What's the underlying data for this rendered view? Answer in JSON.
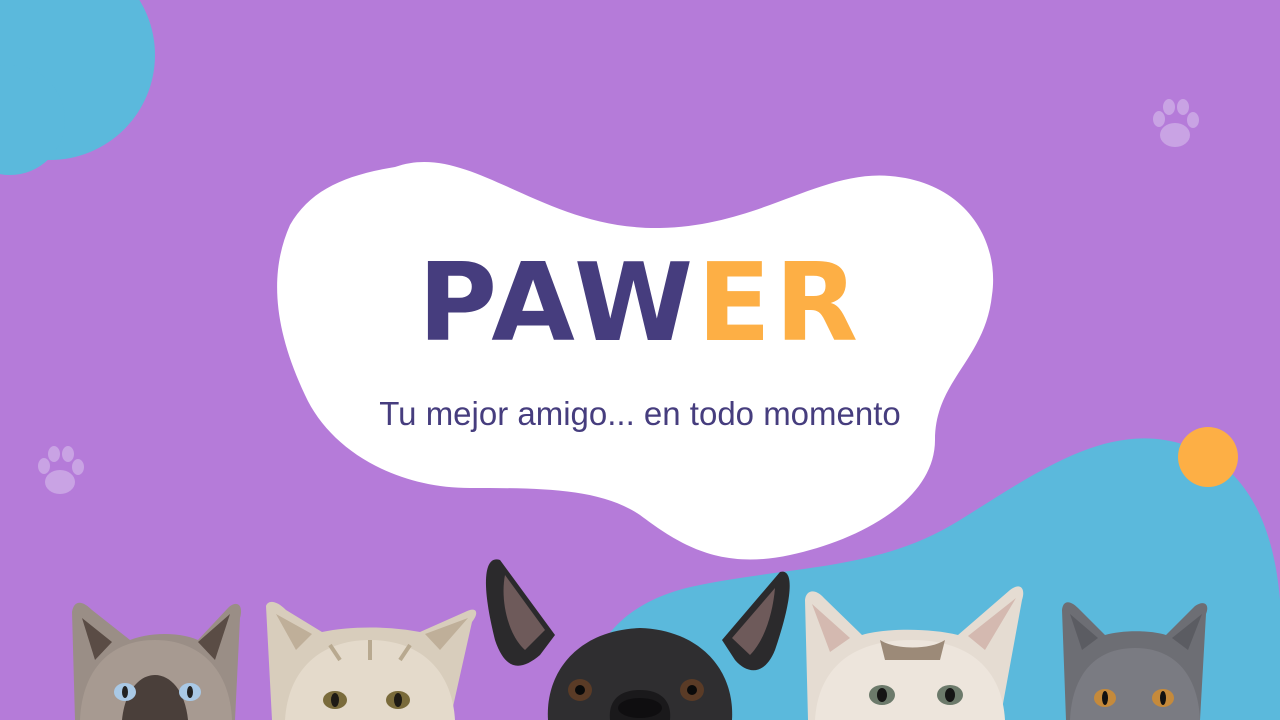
{
  "brand": {
    "name_part_dark": "PAW",
    "name_part_accent": "ER"
  },
  "tagline": "Tu mejor amigo... en todo momento",
  "colors": {
    "background": "#B57BD9",
    "blob_blue": "#5BB9DC",
    "blob_white": "#FFFFFF",
    "brand_dark": "#463D7E",
    "brand_accent": "#FDAF45",
    "dot_orange": "#FDAF45"
  },
  "icons": [
    "paw-print-icon",
    "paw-print-icon"
  ],
  "pets": [
    {
      "type": "cat",
      "name": "cat-siamese-blue-eyes"
    },
    {
      "type": "cat",
      "name": "cat-cream-tabby"
    },
    {
      "type": "dog",
      "name": "dog-french-bulldog"
    },
    {
      "type": "cat",
      "name": "cat-calico-kitten"
    },
    {
      "type": "cat",
      "name": "cat-gray-kitten"
    }
  ]
}
